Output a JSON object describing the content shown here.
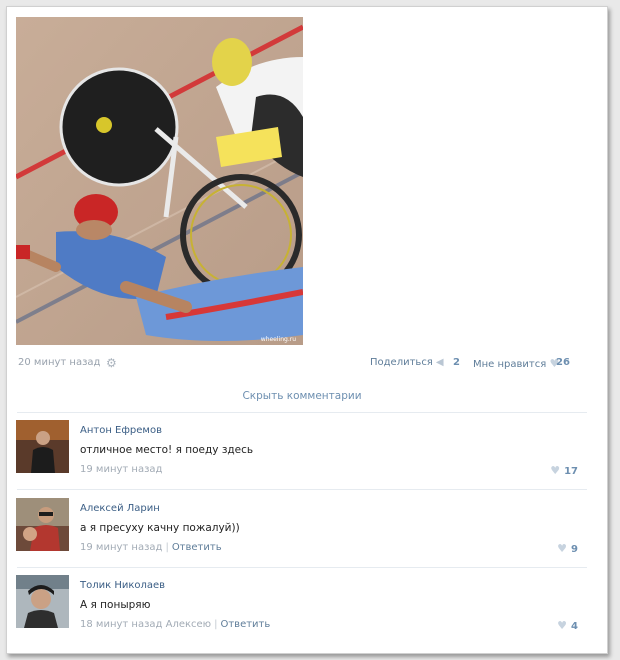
{
  "post": {
    "time": "20 минут назад",
    "share_label": "Поделиться",
    "share_count": "2",
    "like_label": "Мне нравится",
    "like_count": "26",
    "hide_comments": "Скрыть комментарии",
    "photo_watermark": "wheeling.ru"
  },
  "comments": [
    {
      "author": "Антон Ефремов",
      "text": "отличное место! я поеду здесь",
      "time": "19 минут назад",
      "likes": "17"
    },
    {
      "author": "Алексей Ларин",
      "text": "а я пресуху качну пожалуй))",
      "time": "19 минут назад",
      "reply": "Ответить",
      "likes": "9"
    },
    {
      "author": "Толик Николаев",
      "text": "А я поныряю",
      "time": "18 минут назад Алексею",
      "reply": "Ответить",
      "likes": "4"
    }
  ],
  "icons": {
    "gear": "gear-icon",
    "share": "megaphone-icon",
    "heart": "heart-icon"
  },
  "colors": {
    "link": "#5f7d99",
    "count": "#6d8fb0",
    "author": "#3b5e85",
    "muted": "#a2abb5",
    "text": "#222222"
  }
}
